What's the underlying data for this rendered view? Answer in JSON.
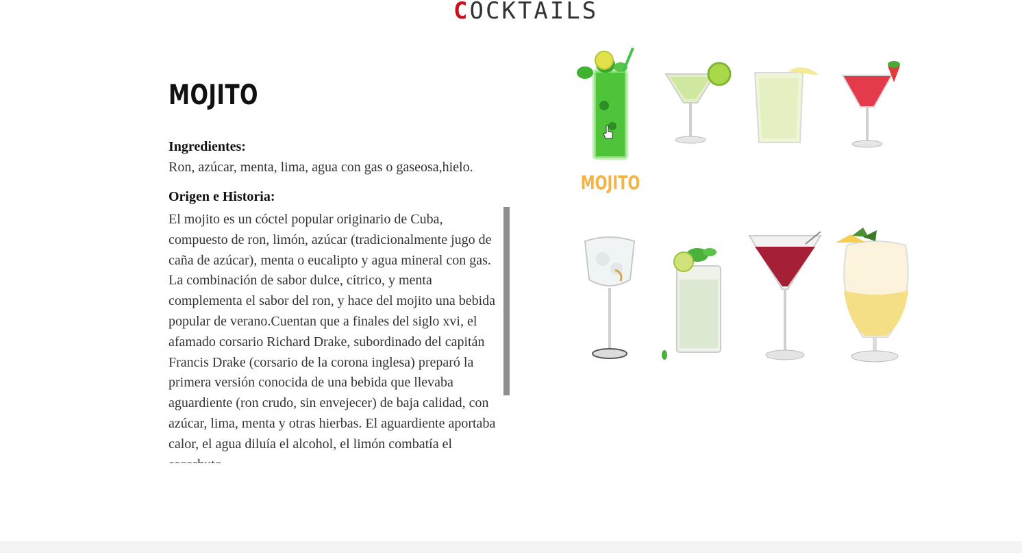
{
  "header": {
    "logo_first_letter": "C",
    "logo_rest": "OCKTAILS",
    "accent_color": "#d0101c"
  },
  "detail": {
    "title": "MOJITO",
    "ingredients_label": "Ingredientes:",
    "ingredients": "Ron, azúcar, menta, lima, agua con gas o gaseosa,hielo.",
    "origin_label": "Origen e Historia:",
    "history": "El mojito es un cóctel popular originario de Cuba, compuesto de ron, limón, azúcar (tradicionalmente jugo de caña de azúcar), menta o eucalipto y agua mineral con gas. La combinación de sabor dulce, cítrico, y menta complementa el sabor del ron, y hace del mojito una bebida popular de verano.Cuentan que a finales del siglo xvi, el afamado corsario Richard Drake, subordinado del capitán Francis Drake (corsario de la corona inglesa) preparó la primera versión conocida de una bebida que llevaba aguardiente (ron crudo, sin envejecer) de baja calidad, con azúcar, lima, menta y otras hierbas. El aguardiente aportaba calor, el agua diluía el alcohol, el limón combatía el escorbuto"
  },
  "gallery": {
    "hovered_label": "MOJITO",
    "hover_color": "#f2b347",
    "items": [
      {
        "icon": "mojito-glass-icon"
      },
      {
        "icon": "margarita-glass-icon"
      },
      {
        "icon": "frozen-lemonade-glass-icon"
      },
      {
        "icon": "strawberry-daiquiri-glass-icon"
      },
      {
        "icon": "gin-tonic-glass-icon"
      },
      {
        "icon": "caipirinha-glass-icon"
      },
      {
        "icon": "cosmopolitan-glass-icon"
      },
      {
        "icon": "pina-colada-glass-icon"
      }
    ]
  }
}
